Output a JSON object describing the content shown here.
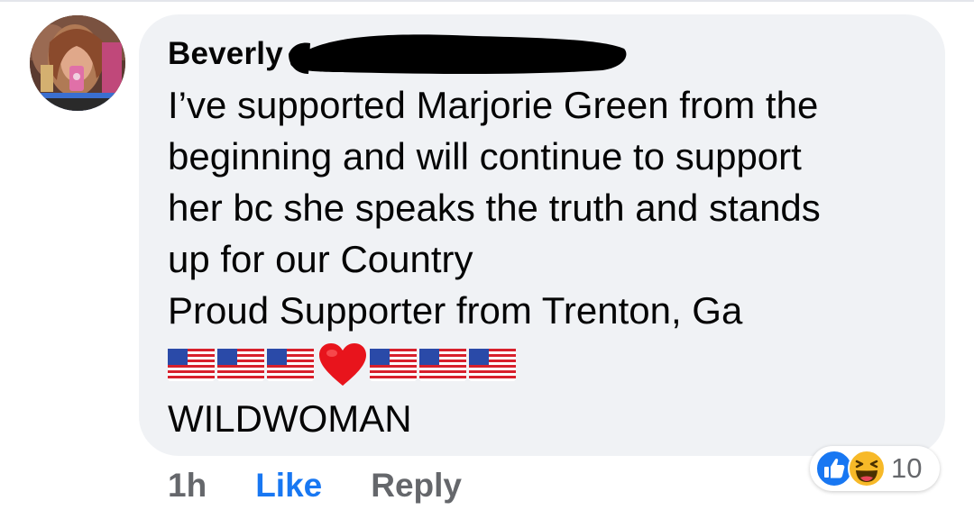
{
  "comment": {
    "author": "Beverly",
    "lines": [
      "I’ve supported Marjorie Green from the",
      "beginning and will continue to support",
      "her bc she speaks the truth and stands",
      "up for our Country",
      "Proud Supporter from Trenton, Ga"
    ],
    "emoji_sequence": [
      "us-flag",
      "us-flag",
      "us-flag",
      "red-heart",
      "us-flag",
      "us-flag",
      "us-flag"
    ],
    "signoff": "WILDWOMAN"
  },
  "actions": {
    "time": "1h",
    "like_label": "Like",
    "reply_label": "Reply"
  },
  "reactions": {
    "types": [
      "like",
      "haha"
    ],
    "count": "10"
  },
  "colors": {
    "bubble": "#f0f2f5",
    "text": "#050505",
    "muted": "#65676b",
    "like_blue": "#1877f2",
    "haha_yellow": "#f7b928",
    "redaction": "#000000"
  },
  "icons": {
    "redaction": "black-marker-redaction",
    "flag": "us-flag-emoji",
    "heart": "red-heart-emoji",
    "like_reaction": "thumbs-up-icon",
    "haha_reaction": "laughing-face-icon"
  }
}
